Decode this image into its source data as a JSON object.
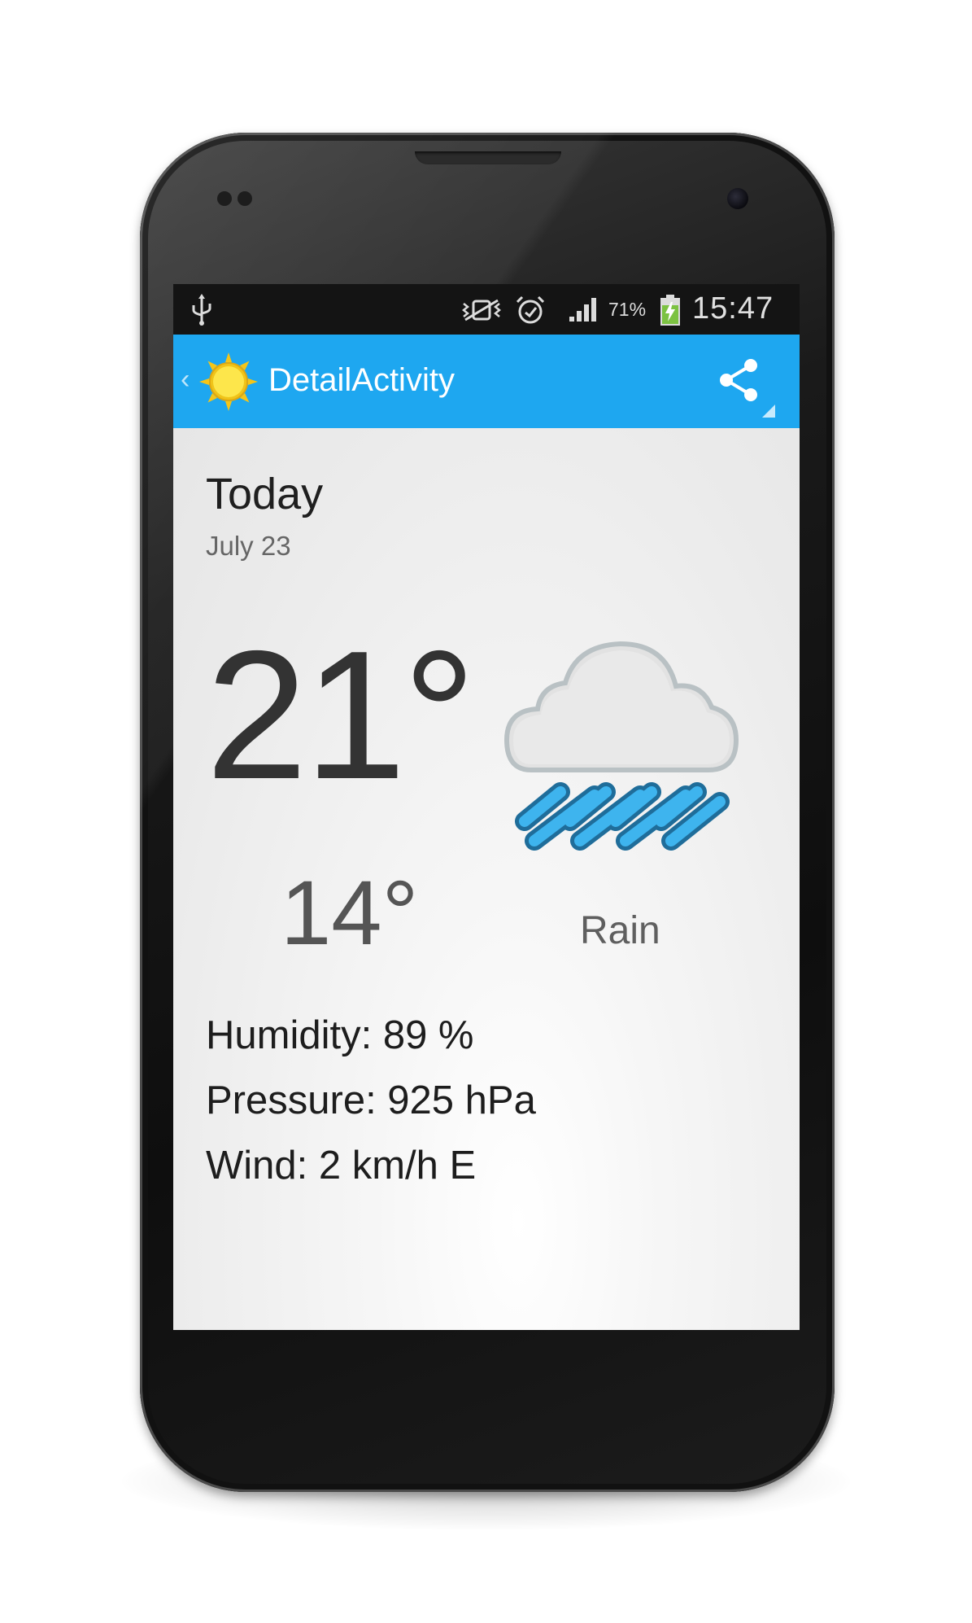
{
  "status_bar": {
    "battery_percent": "71%",
    "time": "15:47",
    "icons": [
      "usb-icon",
      "mute-vibrate-icon",
      "alarm-icon",
      "signal-icon",
      "battery-charging-icon"
    ]
  },
  "action_bar": {
    "title": "DetailActivity",
    "app_icon": "sun-icon",
    "share_icon": "share-icon",
    "color": "#1ea7f0"
  },
  "forecast": {
    "day": "Today",
    "date": "July 23",
    "high": "21°",
    "low": "14°",
    "condition": "Rain",
    "condition_icon": "rain-cloud-icon"
  },
  "details": {
    "humidity": "Humidity: 89 %",
    "pressure": "Pressure: 925 hPa",
    "wind": "Wind: 2 km/h E"
  }
}
